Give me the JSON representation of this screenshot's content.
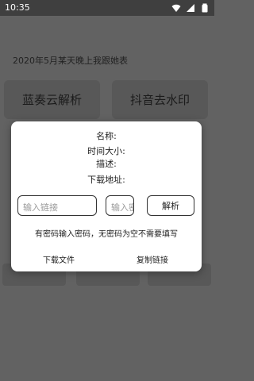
{
  "status_bar": {
    "time": "10:35",
    "icons": [
      "wifi-icon",
      "signal-icon",
      "battery-icon"
    ]
  },
  "background": {
    "headline": "2020年5月某天晚上我跟她表",
    "button_left": "蓝奏云解析",
    "button_right": "抖音去水印"
  },
  "dialog": {
    "name_label": "名称:",
    "time_size_label": "时间大小:",
    "desc_label": "描述:",
    "download_url_label": "下载地址:",
    "link_placeholder": "输入链接",
    "password_placeholder": "输入密码",
    "parse_button": "解析",
    "hint": "有密码输入密码，无密码为空不需要填写",
    "download_button": "下载文件",
    "copy_button": "复制链接"
  },
  "colors": {
    "overlay": "#626262",
    "dialog_bg": "#ffffff",
    "border": "#333333"
  }
}
